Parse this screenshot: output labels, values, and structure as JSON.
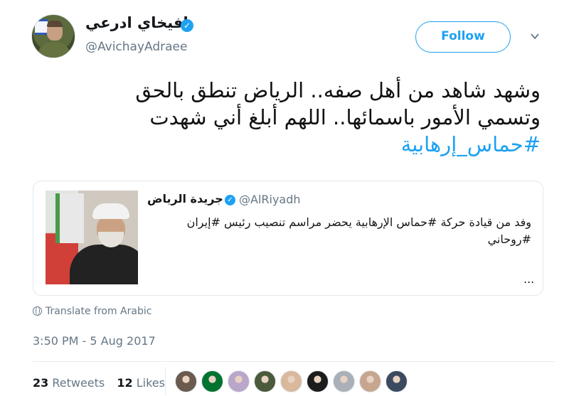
{
  "author": {
    "display_name": "افيخاي ادرعي",
    "handle": "@AvichayAdraee",
    "verified_icon": "verified-badge-icon"
  },
  "follow_label": "Follow",
  "tweet": {
    "line1": "وشهد شاهد من أهل صفه.. الرياض تنطق بالحق",
    "line2": "وتسمي الأمور باسمائها.. اللهم أبلغ أني شهدت",
    "hashtag": "#حماس_إرهابية"
  },
  "quoted": {
    "display_name": "جريدة الرياض",
    "handle": "@AlRiyadh",
    "text_line1": "وفد من قيادة حركة #حماس الإرهابية يحضر مراسم تنصيب رئيس #إيران",
    "text_line2": "#روحاني",
    "ellipsis": "..."
  },
  "translate_label": "Translate from Arabic",
  "timestamp": "3:50 PM - 5 Aug 2017",
  "stats": {
    "retweets_count": "23",
    "retweets_label": "Retweets",
    "likes_count": "12",
    "likes_label": "Likes"
  },
  "likers": [
    {
      "color": "#6b5a4e"
    },
    {
      "color": "#00732f"
    },
    {
      "color": "#b9a6c9"
    },
    {
      "color": "#4a5a3a"
    },
    {
      "color": "#d9b89c"
    },
    {
      "color": "#1c1c1c"
    },
    {
      "color": "#aab0b8"
    },
    {
      "color": "#c7a68f"
    },
    {
      "color": "#3b4a5e"
    }
  ],
  "colors": {
    "accent": "#1da1f2",
    "secondary_text": "#657786"
  }
}
